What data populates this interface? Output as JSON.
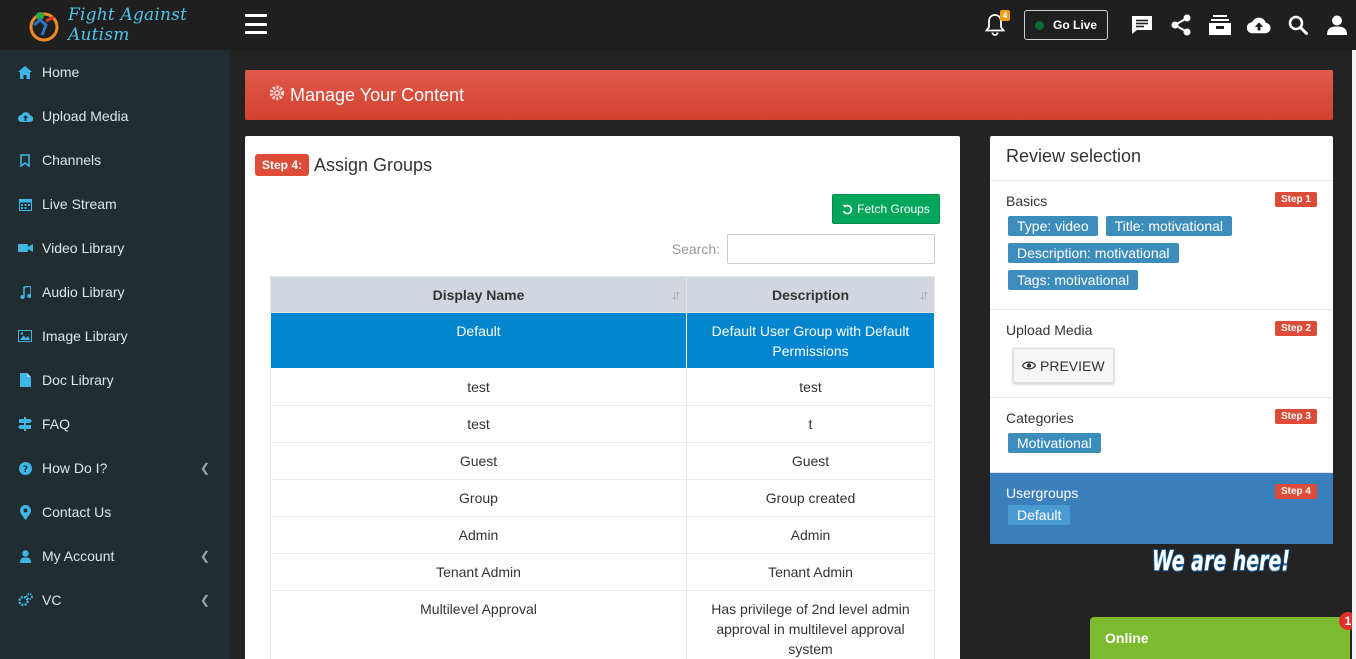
{
  "brand": {
    "name": "Fight Against Autism"
  },
  "sidebar": {
    "items": [
      {
        "label": "Home",
        "icon": "home-icon"
      },
      {
        "label": "Upload Media",
        "icon": "cloud-upload-icon"
      },
      {
        "label": "Channels",
        "icon": "bookmark-icon"
      },
      {
        "label": "Live Stream",
        "icon": "calendar-icon"
      },
      {
        "label": "Video Library",
        "icon": "video-camera-icon"
      },
      {
        "label": "Audio Library",
        "icon": "music-icon"
      },
      {
        "label": "Image Library",
        "icon": "image-icon"
      },
      {
        "label": "Doc Library",
        "icon": "document-icon"
      },
      {
        "label": "FAQ",
        "icon": "signpost-icon"
      },
      {
        "label": "How Do I?",
        "icon": "question-circle-icon"
      },
      {
        "label": "Contact Us",
        "icon": "map-marker-icon"
      },
      {
        "label": "My Account",
        "icon": "user-icon"
      },
      {
        "label": "VC",
        "icon": "cogs-icon"
      }
    ]
  },
  "topbar": {
    "notification_count": "4",
    "go_live_label": "Go Live"
  },
  "content": {
    "banner_title": "Manage Your Content",
    "step": {
      "badge": "Step 4:",
      "title": "Assign Groups",
      "fetch_button": "Fetch Groups",
      "search_label": "Search:",
      "search_value": ""
    },
    "table": {
      "headers": [
        "Display Name",
        "Description"
      ],
      "rows": [
        {
          "name": "Default",
          "description": "Default User Group with Default Permissions",
          "selected": true
        },
        {
          "name": "test",
          "description": "test"
        },
        {
          "name": "test",
          "description": "t"
        },
        {
          "name": "Guest",
          "description": "Guest"
        },
        {
          "name": "Group",
          "description": "Group created"
        },
        {
          "name": "Admin",
          "description": "Admin"
        },
        {
          "name": "Tenant Admin",
          "description": "Tenant Admin"
        },
        {
          "name": "Multilevel Approval",
          "description": "Has privilege of 2nd level admin approval in multilevel approval system"
        }
      ]
    }
  },
  "review": {
    "title": "Review selection",
    "basics": {
      "label": "Basics",
      "step": "Step 1",
      "tags": [
        "Type: video",
        "Title: motivational",
        "Description: motivational",
        "Tags: motivational"
      ]
    },
    "upload": {
      "label": "Upload Media",
      "step": "Step 2",
      "preview_label": "PREVIEW"
    },
    "categories": {
      "label": "Categories",
      "step": "Step 3",
      "tags": [
        "Motivational"
      ]
    },
    "usergroups": {
      "label": "Usergroups",
      "step": "Step 4",
      "tags": [
        "Default"
      ]
    }
  },
  "chat": {
    "status": "Online",
    "badge": "1",
    "headline": "We are here!"
  },
  "colors": {
    "banner": "#dd4b39",
    "selected_row": "#0185cf",
    "tag": "#3c8dbc",
    "fetch_button": "#00a65a",
    "online": "#7cba2f"
  }
}
